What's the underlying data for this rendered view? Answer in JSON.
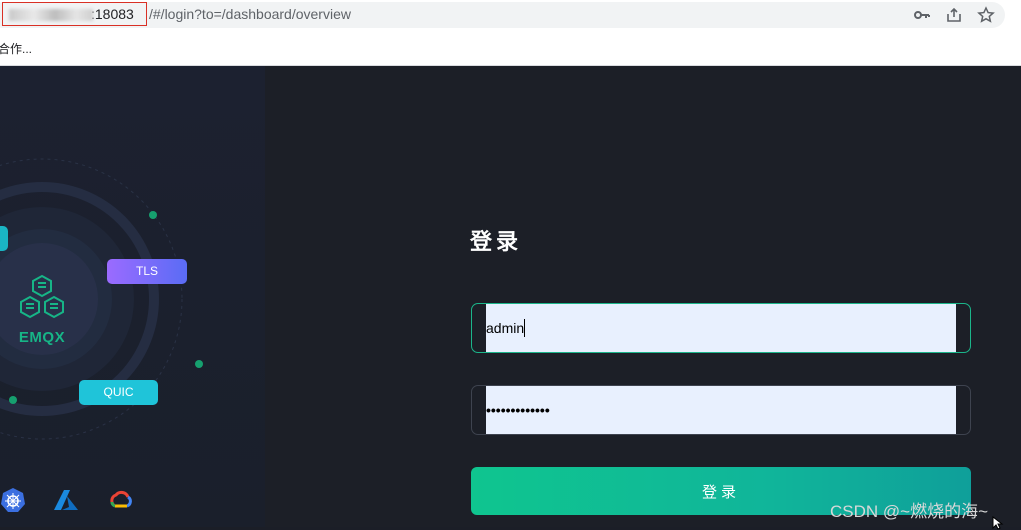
{
  "browser": {
    "url_host_suffix": ":18083",
    "url_path": "/#/login?to=/dashboard/overview",
    "bookmark_label": "合作...",
    "icons": [
      "key-icon",
      "share-icon",
      "star-icon"
    ]
  },
  "hero": {
    "brand": "EMQX",
    "chips": {
      "tls": "TLS",
      "quic": "QUIC"
    },
    "clouds": [
      "kubernetes-icon",
      "azure-icon",
      "google-cloud-icon"
    ]
  },
  "login": {
    "title": "登录",
    "username_value": "admin",
    "password_mask": "•••••••••••••",
    "submit_label": "登录"
  },
  "watermark": "CSDN @~燃烧的海~",
  "colors": {
    "accent": "#1bb58a",
    "background": "#1c1f27",
    "tls_chip": "#7a6bfb",
    "quic_chip": "#1fc4d9"
  }
}
